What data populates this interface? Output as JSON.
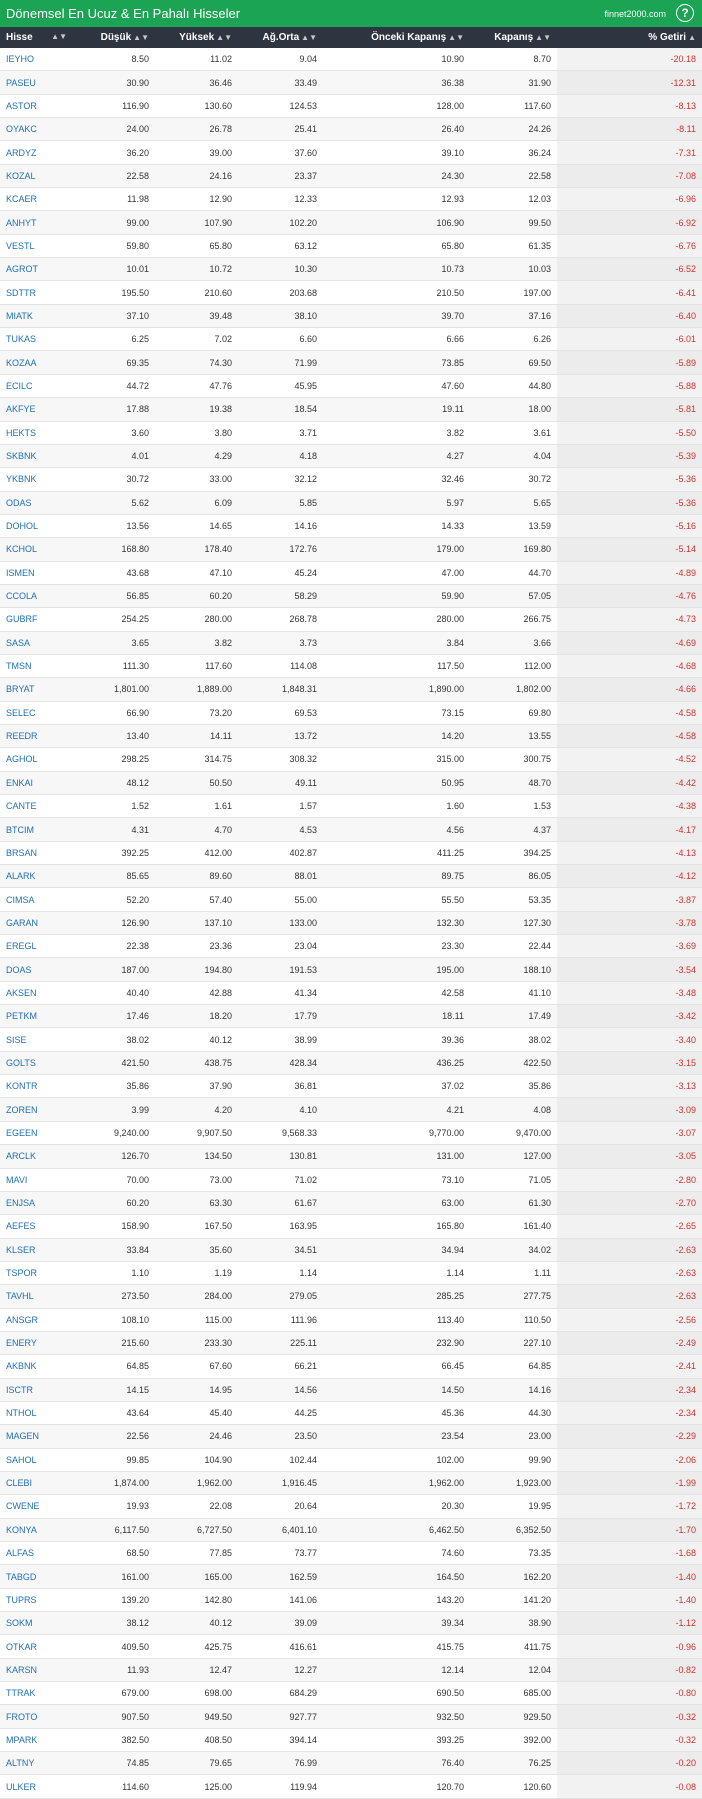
{
  "header": {
    "title": "Dönemsel En Ucuz & En Pahalı Hisseler",
    "brand": "finnet2000.com",
    "help": "?"
  },
  "columns": [
    "Hisse",
    "Düşük",
    "Yüksek",
    "Ağ.Orta",
    "Önceki Kapanış",
    "Kapanış",
    "% Getiri"
  ],
  "rows": [
    [
      "IEYHO",
      "8.50",
      "11.02",
      "9.04",
      "10.90",
      "8.70",
      "-20.18"
    ],
    [
      "PASEU",
      "30.90",
      "36.46",
      "33.49",
      "36.38",
      "31.90",
      "-12.31"
    ],
    [
      "ASTOR",
      "116.90",
      "130.60",
      "124.53",
      "128.00",
      "117.60",
      "-8.13"
    ],
    [
      "OYAKC",
      "24.00",
      "26.78",
      "25.41",
      "26.40",
      "24.26",
      "-8.11"
    ],
    [
      "ARDYZ",
      "36.20",
      "39.00",
      "37.60",
      "39.10",
      "36.24",
      "-7.31"
    ],
    [
      "KOZAL",
      "22.58",
      "24.16",
      "23.37",
      "24.30",
      "22.58",
      "-7.08"
    ],
    [
      "KCAER",
      "11.98",
      "12.90",
      "12.33",
      "12.93",
      "12.03",
      "-6.96"
    ],
    [
      "ANHYT",
      "99.00",
      "107.90",
      "102.20",
      "106.90",
      "99.50",
      "-6.92"
    ],
    [
      "VESTL",
      "59.80",
      "65.80",
      "63.12",
      "65.80",
      "61.35",
      "-6.76"
    ],
    [
      "AGROT",
      "10.01",
      "10.72",
      "10.30",
      "10.73",
      "10.03",
      "-6.52"
    ],
    [
      "SDTTR",
      "195.50",
      "210.60",
      "203.68",
      "210.50",
      "197.00",
      "-6.41"
    ],
    [
      "MIATK",
      "37.10",
      "39.48",
      "38.10",
      "39.70",
      "37.16",
      "-6.40"
    ],
    [
      "TUKAS",
      "6.25",
      "7.02",
      "6.60",
      "6.66",
      "6.26",
      "-6.01"
    ],
    [
      "KOZAA",
      "69.35",
      "74.30",
      "71.99",
      "73.85",
      "69.50",
      "-5.89"
    ],
    [
      "ECILC",
      "44.72",
      "47.76",
      "45.95",
      "47.60",
      "44.80",
      "-5.88"
    ],
    [
      "AKFYE",
      "17.88",
      "19.38",
      "18.54",
      "19.11",
      "18.00",
      "-5.81"
    ],
    [
      "HEKTS",
      "3.60",
      "3.80",
      "3.71",
      "3.82",
      "3.61",
      "-5.50"
    ],
    [
      "SKBNK",
      "4.01",
      "4.29",
      "4.18",
      "4.27",
      "4.04",
      "-5.39"
    ],
    [
      "YKBNK",
      "30.72",
      "33.00",
      "32.12",
      "32.46",
      "30.72",
      "-5.36"
    ],
    [
      "ODAS",
      "5.62",
      "6.09",
      "5.85",
      "5.97",
      "5.65",
      "-5.36"
    ],
    [
      "DOHOL",
      "13.56",
      "14.65",
      "14.16",
      "14.33",
      "13.59",
      "-5.16"
    ],
    [
      "KCHOL",
      "168.80",
      "178.40",
      "172.76",
      "179.00",
      "169.80",
      "-5.14"
    ],
    [
      "ISMEN",
      "43.68",
      "47.10",
      "45.24",
      "47.00",
      "44.70",
      "-4.89"
    ],
    [
      "CCOLA",
      "56.85",
      "60.20",
      "58.29",
      "59.90",
      "57.05",
      "-4.76"
    ],
    [
      "GUBRF",
      "254.25",
      "280.00",
      "268.78",
      "280.00",
      "266.75",
      "-4.73"
    ],
    [
      "SASA",
      "3.65",
      "3.82",
      "3.73",
      "3.84",
      "3.66",
      "-4.69"
    ],
    [
      "TMSN",
      "111.30",
      "117.60",
      "114.08",
      "117.50",
      "112.00",
      "-4.68"
    ],
    [
      "BRYAT",
      "1,801.00",
      "1,889.00",
      "1,848.31",
      "1,890.00",
      "1,802.00",
      "-4.66"
    ],
    [
      "SELEC",
      "66.90",
      "73.20",
      "69.53",
      "73.15",
      "69.80",
      "-4.58"
    ],
    [
      "REEDR",
      "13.40",
      "14.11",
      "13.72",
      "14.20",
      "13.55",
      "-4.58"
    ],
    [
      "AGHOL",
      "298.25",
      "314.75",
      "308.32",
      "315.00",
      "300.75",
      "-4.52"
    ],
    [
      "ENKAI",
      "48.12",
      "50.50",
      "49.11",
      "50.95",
      "48.70",
      "-4.42"
    ],
    [
      "CANTE",
      "1.52",
      "1.61",
      "1.57",
      "1.60",
      "1.53",
      "-4.38"
    ],
    [
      "BTCIM",
      "4.31",
      "4.70",
      "4.53",
      "4.56",
      "4.37",
      "-4.17"
    ],
    [
      "BRSAN",
      "392.25",
      "412.00",
      "402.87",
      "411.25",
      "394.25",
      "-4.13"
    ],
    [
      "ALARK",
      "85.65",
      "89.60",
      "88.01",
      "89.75",
      "86.05",
      "-4.12"
    ],
    [
      "CIMSA",
      "52.20",
      "57.40",
      "55.00",
      "55.50",
      "53.35",
      "-3.87"
    ],
    [
      "GARAN",
      "126.90",
      "137.10",
      "133.00",
      "132.30",
      "127.30",
      "-3.78"
    ],
    [
      "EREGL",
      "22.38",
      "23.36",
      "23.04",
      "23.30",
      "22.44",
      "-3.69"
    ],
    [
      "DOAS",
      "187.00",
      "194.80",
      "191.53",
      "195.00",
      "188.10",
      "-3.54"
    ],
    [
      "AKSEN",
      "40.40",
      "42.88",
      "41.34",
      "42.58",
      "41.10",
      "-3.48"
    ],
    [
      "PETKM",
      "17.46",
      "18.20",
      "17.79",
      "18.11",
      "17.49",
      "-3.42"
    ],
    [
      "SISE",
      "38.02",
      "40.12",
      "38.99",
      "39.36",
      "38.02",
      "-3.40"
    ],
    [
      "GOLTS",
      "421.50",
      "438.75",
      "428.34",
      "436.25",
      "422.50",
      "-3.15"
    ],
    [
      "KONTR",
      "35.86",
      "37.90",
      "36.81",
      "37.02",
      "35.86",
      "-3.13"
    ],
    [
      "ZOREN",
      "3.99",
      "4.20",
      "4.10",
      "4.21",
      "4.08",
      "-3.09"
    ],
    [
      "EGEEN",
      "9,240.00",
      "9,907.50",
      "9,568.33",
      "9,770.00",
      "9,470.00",
      "-3.07"
    ],
    [
      "ARCLK",
      "126.70",
      "134.50",
      "130.81",
      "131.00",
      "127.00",
      "-3.05"
    ],
    [
      "MAVI",
      "70.00",
      "73.00",
      "71.02",
      "73.10",
      "71.05",
      "-2.80"
    ],
    [
      "ENJSA",
      "60.20",
      "63.30",
      "61.67",
      "63.00",
      "61.30",
      "-2.70"
    ],
    [
      "AEFES",
      "158.90",
      "167.50",
      "163.95",
      "165.80",
      "161.40",
      "-2.65"
    ],
    [
      "KLSER",
      "33.84",
      "35.60",
      "34.51",
      "34.94",
      "34.02",
      "-2.63"
    ],
    [
      "TSPOR",
      "1.10",
      "1.19",
      "1.14",
      "1.14",
      "1.11",
      "-2.63"
    ],
    [
      "TAVHL",
      "273.50",
      "284.00",
      "279.05",
      "285.25",
      "277.75",
      "-2.63"
    ],
    [
      "ANSGR",
      "108.10",
      "115.00",
      "111.96",
      "113.40",
      "110.50",
      "-2.56"
    ],
    [
      "ENERY",
      "215.60",
      "233.30",
      "225.11",
      "232.90",
      "227.10",
      "-2.49"
    ],
    [
      "AKBNK",
      "64.85",
      "67.60",
      "66.21",
      "66.45",
      "64.85",
      "-2.41"
    ],
    [
      "ISCTR",
      "14.15",
      "14.95",
      "14.56",
      "14.50",
      "14.16",
      "-2.34"
    ],
    [
      "NTHOL",
      "43.64",
      "45.40",
      "44.25",
      "45.36",
      "44.30",
      "-2.34"
    ],
    [
      "MAGEN",
      "22.56",
      "24.46",
      "23.50",
      "23.54",
      "23.00",
      "-2.29"
    ],
    [
      "SAHOL",
      "99.85",
      "104.90",
      "102.44",
      "102.00",
      "99.90",
      "-2.06"
    ],
    [
      "CLEBI",
      "1,874.00",
      "1,962.00",
      "1,916.45",
      "1,962.00",
      "1,923.00",
      "-1.99"
    ],
    [
      "CWENE",
      "19.93",
      "22.08",
      "20.64",
      "20.30",
      "19.95",
      "-1.72"
    ],
    [
      "KONYA",
      "6,117.50",
      "6,727.50",
      "6,401.10",
      "6,462.50",
      "6,352.50",
      "-1.70"
    ],
    [
      "ALFAS",
      "68.50",
      "77.85",
      "73.77",
      "74.60",
      "73.35",
      "-1.68"
    ],
    [
      "TABGD",
      "161.00",
      "165.00",
      "162.59",
      "164.50",
      "162.20",
      "-1.40"
    ],
    [
      "TUPRS",
      "139.20",
      "142.80",
      "141.06",
      "143.20",
      "141.20",
      "-1.40"
    ],
    [
      "SOKM",
      "38.12",
      "40.12",
      "39.09",
      "39.34",
      "38.90",
      "-1.12"
    ],
    [
      "OTKAR",
      "409.50",
      "425.75",
      "416.61",
      "415.75",
      "411.75",
      "-0.96"
    ],
    [
      "KARSN",
      "11.93",
      "12.47",
      "12.27",
      "12.14",
      "12.04",
      "-0.82"
    ],
    [
      "TTRAK",
      "679.00",
      "698.00",
      "684.29",
      "690.50",
      "685.00",
      "-0.80"
    ],
    [
      "FROTO",
      "907.50",
      "949.50",
      "927.77",
      "932.50",
      "929.50",
      "-0.32"
    ],
    [
      "MPARK",
      "382.50",
      "408.50",
      "394.14",
      "393.25",
      "392.00",
      "-0.32"
    ],
    [
      "ALTNY",
      "74.85",
      "79.65",
      "76.99",
      "76.40",
      "76.25",
      "-0.20"
    ],
    [
      "ULKER",
      "114.60",
      "125.00",
      "119.94",
      "120.70",
      "120.60",
      "-0.08"
    ]
  ]
}
